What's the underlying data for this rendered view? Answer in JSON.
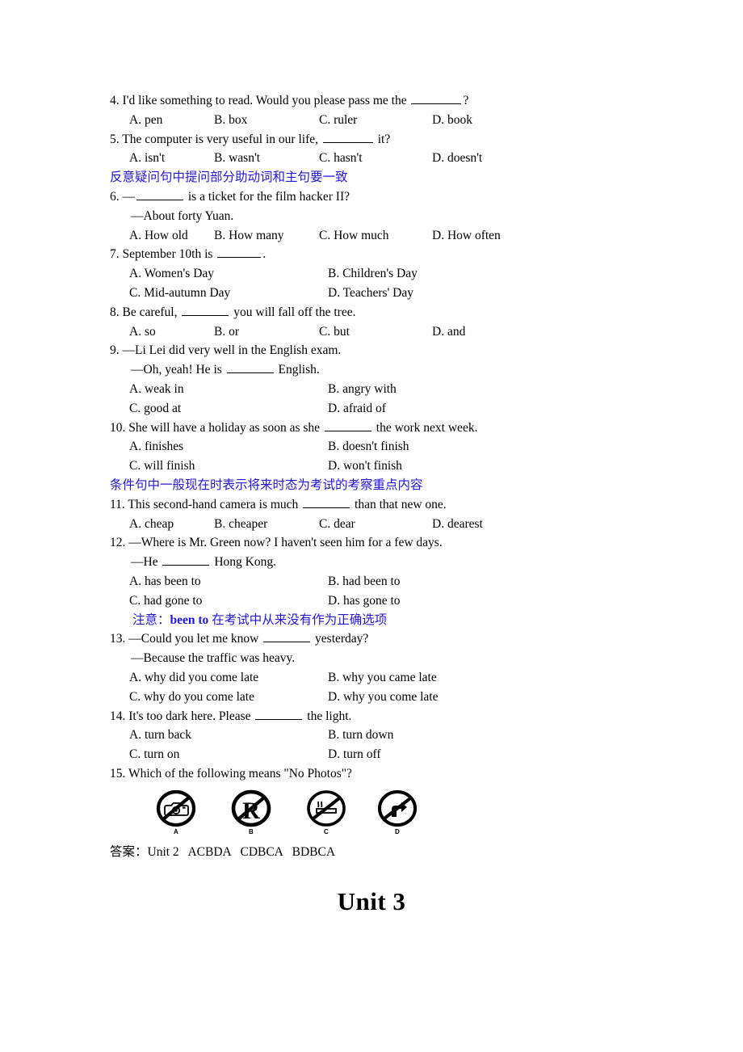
{
  "document": {
    "heading_bottom": "Unit 3",
    "answer_key_line": "答案：Unit 2   ACBDA   CDBCA   BDBCA",
    "note_color": "#2417d6",
    "text_color": "#000000",
    "background": "#ffffff"
  },
  "questions": [
    {
      "number": "4.",
      "stem_before": "4. I'd like something to read. Would you please pass me the ",
      "stem_after": "?",
      "layout": "four",
      "options": [
        "A. pen",
        "B. box",
        "C. ruler",
        "D. book"
      ]
    },
    {
      "number": "5.",
      "stem_before": "5. The computer is very useful in our life, ",
      "stem_after": " it?",
      "layout": "four",
      "options": [
        "A. isn't",
        "B. wasn't",
        "C. hasn't",
        "D. doesn't"
      ]
    },
    {
      "number": "6.",
      "stem_before": "6. —",
      "stem_after": " is a ticket for the film hacker II?",
      "second_line": "—About forty Yuan.",
      "layout": "four",
      "options": [
        "A. How old",
        "B. How many",
        "C. How much",
        "D. How often"
      ]
    },
    {
      "number": "7.",
      "stem_before": "7. September 10th is ",
      "stem_after": ".",
      "layout": "two",
      "options": [
        "A. Women's Day",
        "B. Children's Day",
        "C. Mid-autumn Day",
        "D. Teachers' Day"
      ]
    },
    {
      "number": "8.",
      "stem_before": "8. Be careful, ",
      "stem_after": " you will fall off the tree.",
      "layout": "four",
      "options": [
        "A. so",
        "B. or",
        "C. but",
        "D. and"
      ]
    },
    {
      "number": "9.",
      "stem_before": "9. —Li Lei did very well in the English exam.",
      "second_line_before": "—Oh, yeah! He is ",
      "second_line_after": " English.",
      "layout": "two",
      "options": [
        "A. weak in",
        "B. angry with",
        "C. good at",
        "D. afraid of"
      ]
    },
    {
      "number": "10.",
      "stem_before": "10. She will have a holiday as soon as she ",
      "stem_after": " the work next week.",
      "layout": "two",
      "options": [
        "A. finishes",
        "B. doesn't finish",
        "C. will finish",
        "D. won't finish"
      ]
    },
    {
      "number": "11.",
      "stem_before": "11. This second-hand camera is much ",
      "stem_after": " than that new one.",
      "layout": "four",
      "options": [
        "A. cheap",
        "B. cheaper",
        "C. dear",
        "D. dearest"
      ]
    },
    {
      "number": "12.",
      "stem_before": "12. —Where is Mr. Green now? I haven't seen him for a few days.",
      "second_line_before": "—He ",
      "second_line_after": " Hong Kong.",
      "layout": "two",
      "options": [
        "A. has been to",
        "B. had been to",
        "C. had gone to",
        "D. has gone to"
      ]
    },
    {
      "number": "13.",
      "stem_before": "13. —Could you let me know ",
      "stem_after": " yesterday?",
      "second_line": "—Because the traffic was heavy.",
      "layout": "two",
      "options": [
        "A. why did you come late",
        "B. why you came late",
        "C. why do you come late",
        "D. why you come late"
      ]
    },
    {
      "number": "14.",
      "stem_before": "14. It's too dark here. Please ",
      "stem_after": " the light.",
      "layout": "two",
      "options": [
        "A. turn back",
        "B. turn down",
        "C. turn on",
        "D. turn off"
      ]
    },
    {
      "number": "15.",
      "stem_before": "15. Which of the following means \"No Photos\"?",
      "layout": "images",
      "image_options": [
        {
          "label": "A",
          "icon": "no-camera-icon"
        },
        {
          "label": "B",
          "icon": "no-parking-icon"
        },
        {
          "label": "C",
          "icon": "no-smoking-icon"
        },
        {
          "label": "D",
          "icon": "no-right-turn-icon"
        }
      ]
    }
  ],
  "notes": [
    {
      "id": "note5",
      "text": "反意疑问句中提问部分助动词和主句要一致"
    },
    {
      "id": "note10",
      "text": "条件句中一般现在时表示将来时态为考试的考察重点内容"
    },
    {
      "id": "note12_prefix",
      "text": "注意："
    },
    {
      "id": "note12_bold",
      "text": "been to"
    },
    {
      "id": "note12_suffix",
      "text": "在考试中从来没有作为正确选项"
    }
  ]
}
